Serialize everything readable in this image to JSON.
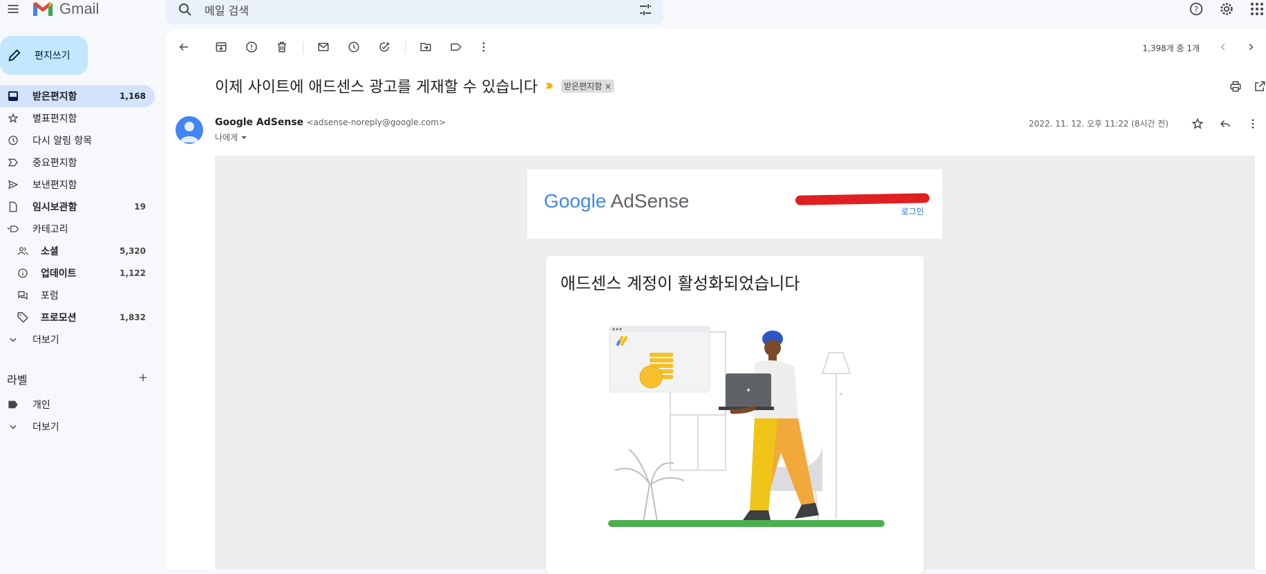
{
  "app": {
    "name": "Gmail"
  },
  "search": {
    "placeholder": "메일 검색"
  },
  "sidebar": {
    "compose_label": "편지쓰기",
    "items": [
      {
        "label": "받은편지함",
        "count": "1,168",
        "icon": "inbox-icon",
        "active": true
      },
      {
        "label": "별표편지함",
        "count": "",
        "icon": "star-icon"
      },
      {
        "label": "다시 알림 항목",
        "count": "",
        "icon": "clock-icon"
      },
      {
        "label": "중요편지함",
        "count": "",
        "icon": "important-icon"
      },
      {
        "label": "보낸편지함",
        "count": "",
        "icon": "send-icon"
      },
      {
        "label": "임시보관함",
        "count": "19",
        "icon": "draft-icon"
      },
      {
        "label": "카테고리",
        "count": "",
        "icon": "label-icon"
      },
      {
        "label": "소셜",
        "count": "5,320",
        "icon": "people-icon"
      },
      {
        "label": "업데이트",
        "count": "1,122",
        "icon": "info-icon"
      },
      {
        "label": "포럼",
        "count": "",
        "icon": "forum-icon"
      },
      {
        "label": "프로모션",
        "count": "1,832",
        "icon": "tag-icon"
      },
      {
        "label": "더보기",
        "count": "",
        "icon": "chevron-down-icon"
      }
    ],
    "labels_heading": "라벨",
    "labels": [
      {
        "label": "개인",
        "icon": "label-filled-icon"
      },
      {
        "label": "더보기",
        "icon": "chevron-down-icon"
      }
    ]
  },
  "toolbar": {
    "pager": "1,398개 중 1개"
  },
  "email": {
    "subject": "이제 사이트에 애드센스 광고를 게재할 수 있습니다",
    "label_chip": "받은편지함",
    "sender_name": "Google AdSense",
    "sender_email": "<adsense-noreply@google.com>",
    "to": "나에게",
    "date": "2022. 11. 12. 오후 11:22 (8시간 전)"
  },
  "content": {
    "brand_google": "Google",
    "brand_product": "AdSense",
    "login": "로그인",
    "headline": "애드센스 계정이 활성화되었습니다"
  },
  "colors": {
    "accent": "#c2e7ff",
    "active_nav": "#d3e3fd",
    "link": "#1a73e8",
    "redaction": "#e02020"
  }
}
